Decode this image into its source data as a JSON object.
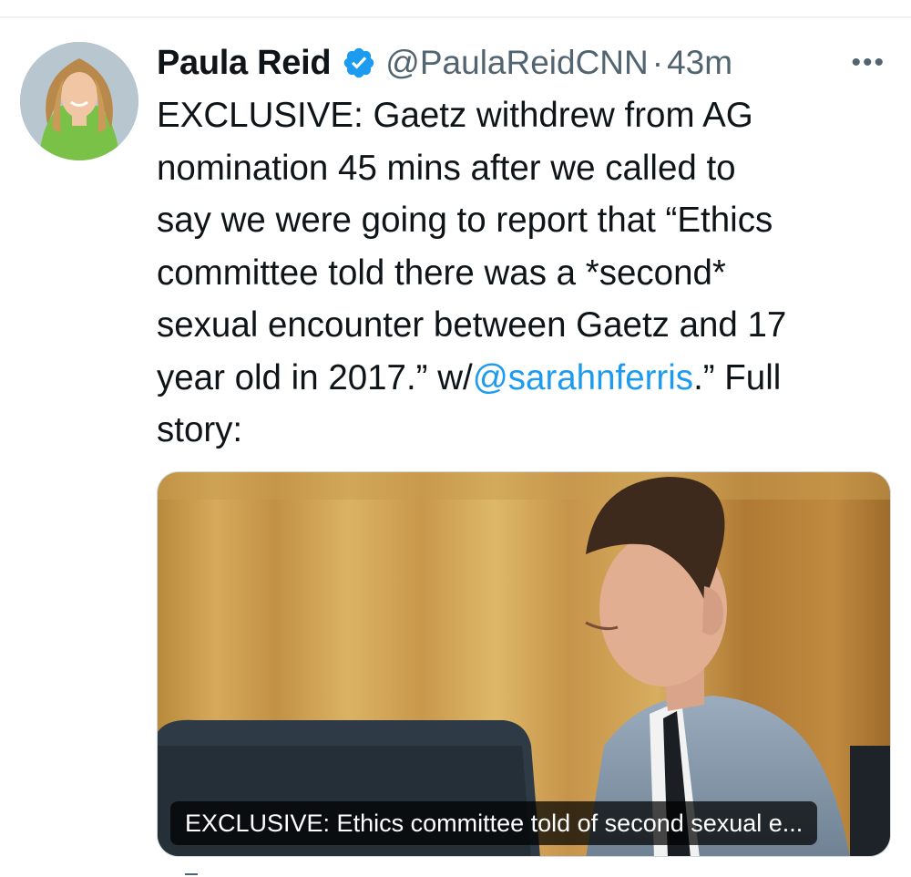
{
  "tweet": {
    "author_name": "Paula Reid",
    "author_handle": "@PaulaReidCNN",
    "separator": "·",
    "time": "43m",
    "more_label": "•••",
    "text_before": "EXCLUSIVE: Gaetz withdrew from AG\nnomination 45 mins after we called to\nsay we were going to report that “Ethics\ncommittee told there was a *second*\nsexual encounter between Gaetz and 17\nyear old in 2017.” w/",
    "mention": "@sarahnferris",
    "text_after": ".” Full\nstory:",
    "verified": true
  },
  "card": {
    "caption": "EXCLUSIVE: Ethics committee told of second sexual e..."
  },
  "colors": {
    "link": "#1d9bf0",
    "verified_badge": "#1d9bf0",
    "muted": "#536471",
    "text": "#0f1419"
  },
  "icons": {
    "verified": "verified-badge-icon",
    "more": "more-options-icon"
  }
}
